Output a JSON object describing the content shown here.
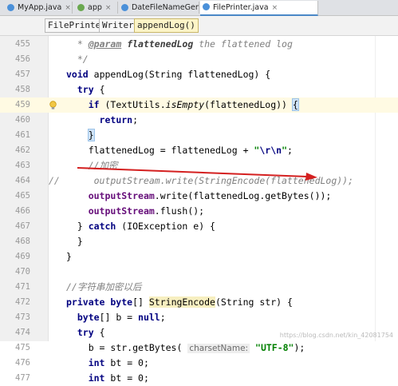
{
  "tabs": [
    {
      "label": "MyApp.java",
      "icon_color": "#4a90d9"
    },
    {
      "label": "app",
      "icon_color": "#6aa84f"
    },
    {
      "label": "DateFileNameGenerator.java",
      "icon_color": "#4a90d9"
    },
    {
      "label": "FilePrinter.java",
      "icon_color": "#4a90d9",
      "active": true
    }
  ],
  "tab_close_glyph": "×",
  "breadcrumbs": [
    "FilePrinter",
    "Writer",
    "appendLog()"
  ],
  "code_lines": [
    {
      "n": "455",
      "parts": [
        [
          "cm",
          "* "
        ],
        [
          "tag",
          "@param"
        ],
        [
          "tagv",
          " flattenedLog"
        ],
        [
          "cm",
          " the flattened log"
        ]
      ],
      "indent": "  "
    },
    {
      "n": "456",
      "parts": [
        [
          "cm",
          "*/"
        ]
      ],
      "indent": "  "
    },
    {
      "n": "457",
      "parts": [
        [
          "kw",
          "void"
        ],
        [
          "",
          "appendLog(String flattenedLog) {"
        ]
      ],
      "indent": ""
    },
    {
      "n": "458",
      "parts": [
        [
          "kw",
          "try"
        ],
        [
          "",
          " {"
        ]
      ],
      "indent": "  "
    },
    {
      "n": "459",
      "parts": [
        [
          "kw",
          "if"
        ],
        [
          "",
          " (TextUtils."
        ],
        [
          "mtd",
          "isEmpty"
        ],
        [
          "",
          "(flattenedLog)) "
        ],
        [
          "brace",
          "{"
        ]
      ],
      "indent": "    ",
      "hl": true,
      "bulb": true
    },
    {
      "n": "460",
      "parts": [
        [
          "kw",
          "return"
        ],
        [
          "",
          ";"
        ]
      ],
      "indent": "      "
    },
    {
      "n": "461",
      "parts": [
        [
          "brace",
          "}"
        ]
      ],
      "indent": "    "
    },
    {
      "n": "462",
      "parts": [
        [
          "",
          "flattenedLog = flattenedLog + "
        ],
        [
          "str",
          "\""
        ],
        [
          "esc",
          "\\r\\n"
        ],
        [
          "str",
          "\""
        ],
        [
          "",
          ";"
        ]
      ],
      "indent": "    "
    },
    {
      "n": "463",
      "parts": [
        [
          "cm",
          "//加密"
        ]
      ],
      "indent": "    "
    },
    {
      "n": "464",
      "parts": [
        [
          "cm",
          "outputStream.write(StringEncode(flattenedLog));"
        ]
      ],
      "indent": "     ",
      "commented": true
    },
    {
      "n": "465",
      "parts": [
        [
          "fld",
          "outputStream"
        ],
        [
          "",
          ".write(flattenedLog.getBytes());"
        ]
      ],
      "indent": "    "
    },
    {
      "n": "466",
      "parts": [
        [
          "fld",
          "outputStream"
        ],
        [
          "",
          ".flush();"
        ]
      ],
      "indent": "    "
    },
    {
      "n": "467",
      "parts": [
        [
          "",
          "} "
        ],
        [
          "kw",
          "catch"
        ],
        [
          "",
          " (IOException e) {"
        ]
      ],
      "indent": "  "
    },
    {
      "n": "468",
      "parts": [
        [
          "",
          "}"
        ]
      ],
      "indent": "  "
    },
    {
      "n": "469",
      "parts": [
        [
          "",
          "}"
        ]
      ],
      "indent": ""
    },
    {
      "n": "470",
      "parts": [],
      "indent": ""
    },
    {
      "n": "471",
      "parts": [
        [
          "cm",
          "//字符串加密以后"
        ]
      ],
      "indent": ""
    },
    {
      "n": "472",
      "parts": [
        [
          "kw",
          "private byte"
        ],
        [
          "",
          "[] "
        ],
        [
          "yhl",
          "StringEncode"
        ],
        [
          "",
          "(String str) {"
        ]
      ],
      "indent": ""
    },
    {
      "n": "473",
      "parts": [
        [
          "kw",
          "byte"
        ],
        [
          "",
          "[] b = "
        ],
        [
          "kw",
          "null"
        ],
        [
          "",
          ";"
        ]
      ],
      "indent": "  "
    },
    {
      "n": "474",
      "parts": [
        [
          "kw",
          "try"
        ],
        [
          "",
          " {"
        ]
      ],
      "indent": "  "
    },
    {
      "n": "475",
      "parts": [
        [
          "",
          "b = str.getBytes( "
        ],
        [
          "hint",
          "charsetName:"
        ],
        [
          "",
          " "
        ],
        [
          "str",
          "\"UTF-8\""
        ],
        [
          "",
          ");"
        ]
      ],
      "indent": "    "
    },
    {
      "n": "476",
      "parts": [
        [
          "kw",
          "int"
        ],
        [
          "",
          "bt = 0;"
        ]
      ],
      "indent": "    "
    },
    {
      "n": "477",
      "parts": [
        [
          "kw",
          "int"
        ],
        [
          "",
          "bt = 0;"
        ]
      ],
      "indent": "    "
    }
  ],
  "commented_prefix": "//",
  "watermark": "https://blog.csdn.net/kin_42081754"
}
